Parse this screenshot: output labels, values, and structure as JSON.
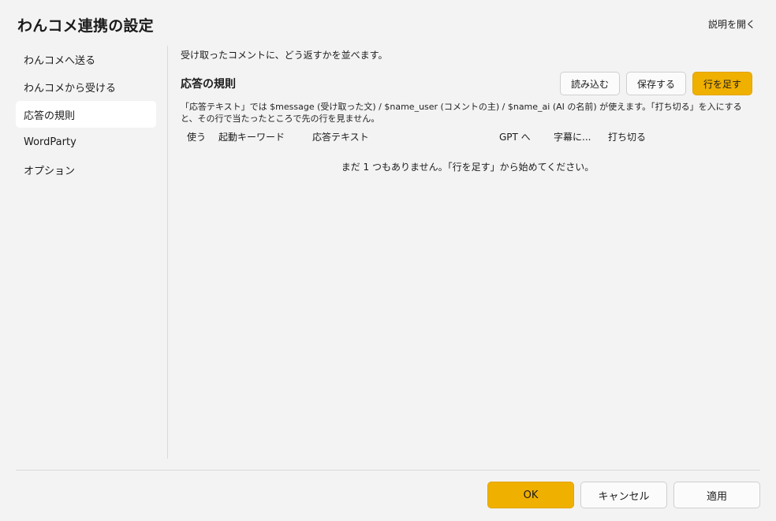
{
  "dialog": {
    "title": "わんコメ連携の設定",
    "help_link": "説明を開く"
  },
  "sidebar": {
    "items": [
      {
        "label": "わんコメへ送る"
      },
      {
        "label": "わんコメから受ける"
      },
      {
        "label": "応答の規則",
        "active": true
      },
      {
        "label": "WordParty"
      },
      {
        "label": "オプション"
      }
    ]
  },
  "main": {
    "intro": "受け取ったコメントに、どう返すかを並べます。",
    "section_title": "応答の規則",
    "toolbar": {
      "load_label": "読み込む",
      "save_label": "保存する",
      "add_row_label": "行を足す"
    },
    "note": "「応答テキスト」では $message (受け取った文) / $name_user (コメントの主) / $name_ai (AI の名前) が使えます。「打ち切る」を入にすると、その行で当たったところで先の行を見ません。",
    "columns": [
      "使う",
      "起動キーワード",
      "応答テキスト",
      "GPT へ",
      "字幕に...",
      "打ち切る"
    ],
    "empty_message": "まだ 1 つもありません。「行を足す」から始めてください。"
  },
  "footer": {
    "ok_label": "OK",
    "cancel_label": "キャンセル",
    "apply_label": "適用"
  },
  "colors": {
    "accent": "#f0b000",
    "background": "#f3f3f3",
    "active_item": "#ffffff"
  }
}
